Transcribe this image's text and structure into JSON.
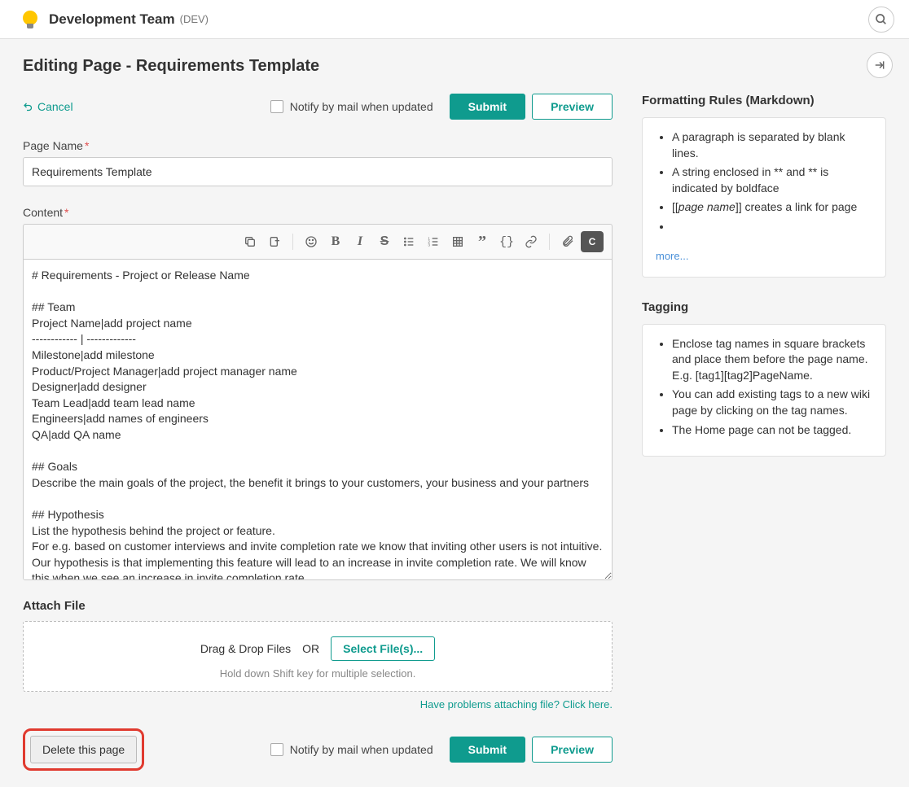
{
  "header": {
    "team_name": "Development Team",
    "team_code": "(DEV)"
  },
  "page": {
    "editing_title": "Editing Page - Requirements Template",
    "cancel_label": "Cancel",
    "notify_label": "Notify by mail when updated",
    "submit_label": "Submit",
    "preview_label": "Preview",
    "page_name_label": "Page Name",
    "page_name_value": "Requirements Template",
    "content_label": "Content",
    "content_value": "# Requirements - Project or Release Name\n\n## Team\nProject Name|add project name\n------------ | -------------\nMilestone|add milestone\nProduct/Project Manager|add project manager name\nDesigner|add designer\nTeam Lead|add team lead name\nEngineers|add names of engineers\nQA|add QA name\n\n## Goals\nDescribe the main goals of the project, the benefit it brings to your customers, your business and your partners\n\n## Hypothesis\nList the hypothesis behind the project or feature.\nFor e.g. based on customer interviews and invite completion rate we know that inviting other users is not intuitive. Our hypothesis is that implementing this feature will lead to an increase in invite completion rate. We will know this when we see an increase in invite completion rate",
    "attach_title": "Attach File",
    "attach_drag": "Drag & Drop Files",
    "attach_or": "OR",
    "attach_select": "Select File(s)...",
    "attach_hint": "Hold down Shift key for multiple selection.",
    "attach_help": "Have problems attaching file? Click here.",
    "delete_label": "Delete this page"
  },
  "sidebar": {
    "formatting_title": "Formatting Rules (Markdown)",
    "formatting_rules": [
      "A paragraph is separated by blank lines.",
      "A string enclosed in ** and ** is indicated by boldface",
      "[[page name]] creates a link for page",
      ""
    ],
    "more_label": "more...",
    "tagging_title": "Tagging",
    "tagging_rules": [
      "Enclose tag names in square brackets and place them before the page name. E.g. [tag1][tag2]PageName.",
      "You can add existing tags to a new wiki page by clicking on the tag names.",
      "The Home page can not be tagged."
    ]
  }
}
